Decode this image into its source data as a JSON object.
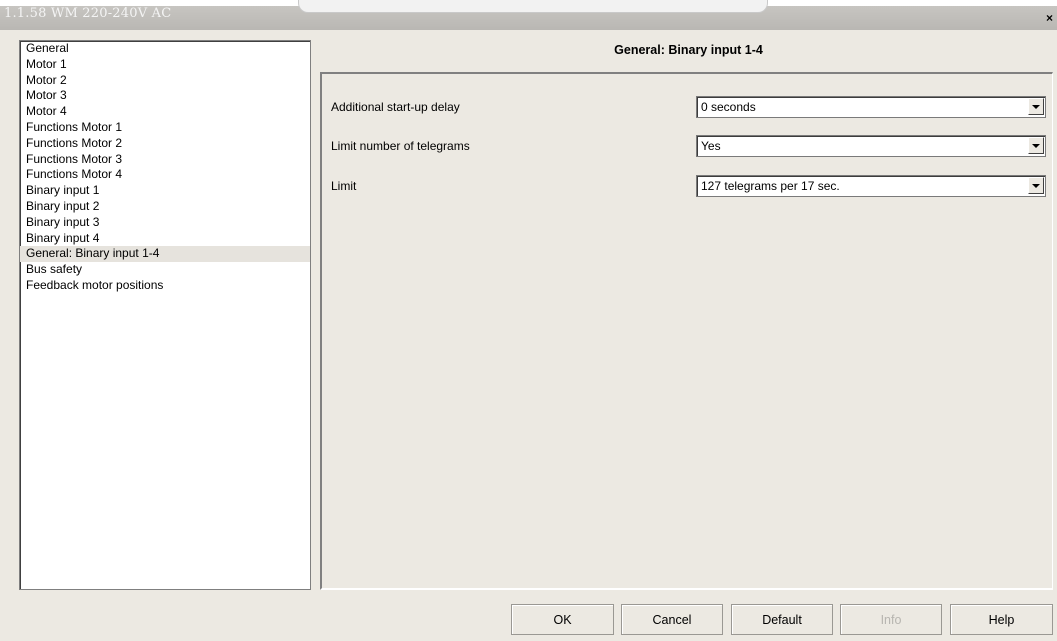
{
  "window": {
    "title": "1.1.58 WM 220-240V AC",
    "close_symbol": "×"
  },
  "sidebar": {
    "items": [
      {
        "label": "General"
      },
      {
        "label": "Motor 1"
      },
      {
        "label": "Motor 2"
      },
      {
        "label": "Motor 3"
      },
      {
        "label": "Motor 4"
      },
      {
        "label": "Functions Motor 1"
      },
      {
        "label": "Functions Motor 2"
      },
      {
        "label": "Functions Motor 3"
      },
      {
        "label": "Functions Motor 4"
      },
      {
        "label": "Binary input 1"
      },
      {
        "label": "Binary input 2"
      },
      {
        "label": "Binary input 3"
      },
      {
        "label": "Binary input 4"
      },
      {
        "label": "General: Binary input 1-4",
        "selected": true
      },
      {
        "label": "Bus safety"
      },
      {
        "label": "Feedback motor positions"
      }
    ]
  },
  "main": {
    "header": "General: Binary input 1-4",
    "params": [
      {
        "label": "Additional start-up delay",
        "value": "0 seconds"
      },
      {
        "label": "Limit number of telegrams",
        "value": "Yes"
      },
      {
        "label": "Limit",
        "value": "127 telegrams per 17 sec."
      }
    ]
  },
  "buttons": {
    "ok": "OK",
    "cancel": "Cancel",
    "default": "Default",
    "info": "Info",
    "help": "Help"
  },
  "icons": {
    "close": "close-icon",
    "dropdown": "chevron-down-icon"
  }
}
